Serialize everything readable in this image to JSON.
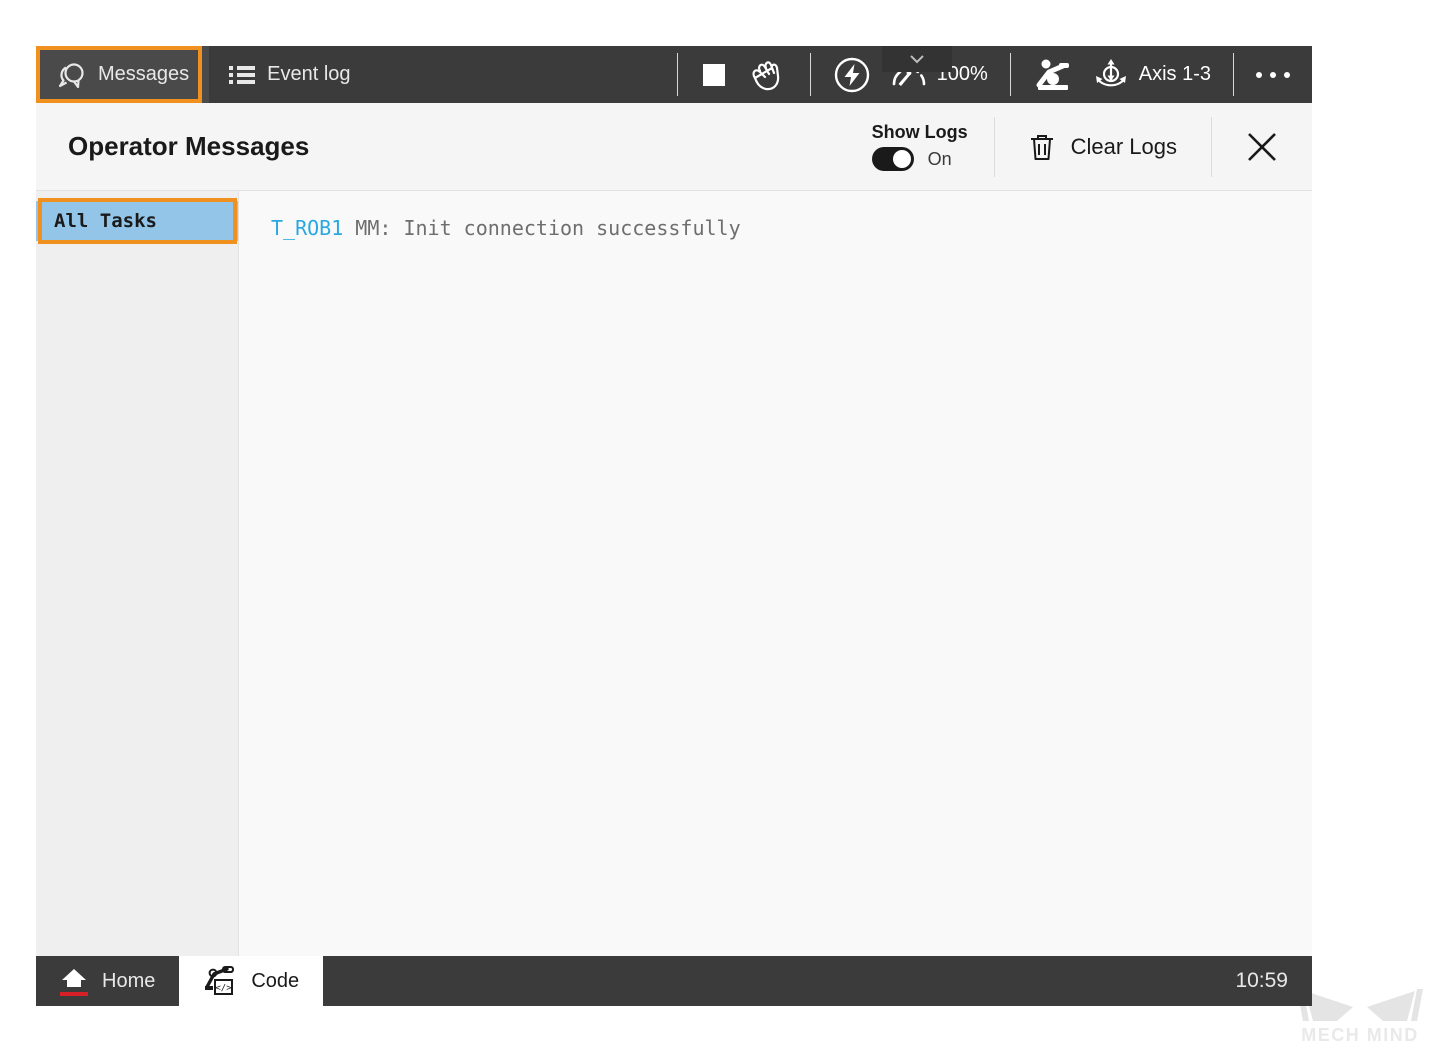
{
  "toolbar": {
    "tabs": [
      {
        "label": "Messages",
        "icon": "messages-icon",
        "active": true
      },
      {
        "label": "Event log",
        "icon": "event-log-icon",
        "active": false
      }
    ],
    "stop_button": {
      "icon": "stop-icon"
    },
    "hand_button": {
      "icon": "hand-icon"
    },
    "motors_button": {
      "icon": "lightning-bolt-circle-icon"
    },
    "speed": {
      "icon": "speed-gauge-icon",
      "value": "100%",
      "dropdown_icon": "chevron-down-icon"
    },
    "robot_button": {
      "icon": "robot-arm-icon"
    },
    "axis_button": {
      "icon": "axis-rotation-icon",
      "label": "Axis 1-3"
    },
    "more_button": {
      "icon": "ellipsis-icon"
    }
  },
  "header": {
    "title": "Operator Messages",
    "show_logs_label": "Show Logs",
    "show_logs_state": "On",
    "clear_logs_label": "Clear Logs",
    "clear_logs_icon": "trash-icon",
    "close_icon": "close-icon"
  },
  "sidebar": {
    "items": [
      {
        "label": "All Tasks",
        "selected": true
      }
    ]
  },
  "log": {
    "lines": [
      {
        "task": "T_ROB1",
        "message": " MM: Init connection successfully"
      }
    ]
  },
  "bottombar": {
    "home": {
      "label": "Home",
      "icon": "home-icon"
    },
    "code": {
      "label": "Code",
      "icon": "robot-code-icon"
    },
    "clock": "10:59"
  },
  "watermark": {
    "text": "MECH MIND"
  },
  "colors": {
    "toolbar_bg": "#3b3b3b",
    "panel_bg": "#f5f5f5",
    "highlight_orange": "#f0901e",
    "selection_blue": "#92c5e8",
    "task_cyan": "#2aa9e0",
    "home_red": "#d71f27"
  }
}
